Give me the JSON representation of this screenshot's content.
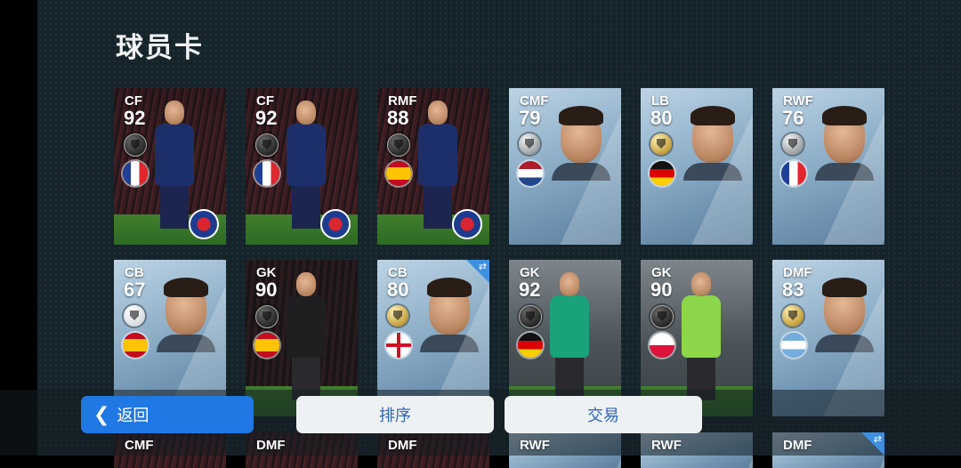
{
  "page": {
    "title": "球员卡"
  },
  "cards": [
    {
      "pos": "CF",
      "ovr": "92",
      "tier": "black",
      "flag": "fr",
      "style": "photo",
      "club": true
    },
    {
      "pos": "CF",
      "ovr": "92",
      "tier": "black",
      "flag": "fr",
      "style": "photo",
      "club": true
    },
    {
      "pos": "RMF",
      "ovr": "88",
      "tier": "black",
      "flag": "es",
      "style": "photo",
      "club": true
    },
    {
      "pos": "CMF",
      "ovr": "79",
      "tier": "silver",
      "flag": "nl",
      "style": "portrait",
      "club": false
    },
    {
      "pos": "LB",
      "ovr": "80",
      "tier": "gold",
      "flag": "de",
      "style": "portrait",
      "club": false
    },
    {
      "pos": "RWF",
      "ovr": "76",
      "tier": "silver",
      "flag": "fr",
      "style": "portrait",
      "club": false
    },
    {
      "pos": "CB",
      "ovr": "67",
      "tier": "white",
      "flag": "es",
      "style": "portrait",
      "club": false
    },
    {
      "pos": "GK",
      "ovr": "90",
      "tier": "black",
      "flag": "es",
      "style": "photo-dark",
      "club": false
    },
    {
      "pos": "CB",
      "ovr": "80",
      "tier": "gold",
      "flag": "en",
      "style": "portrait",
      "club": false,
      "swap": true
    },
    {
      "pos": "GK",
      "ovr": "92",
      "tier": "black",
      "flag": "de",
      "style": "photo-stadium",
      "club": false
    },
    {
      "pos": "GK",
      "ovr": "90",
      "tier": "black",
      "flag": "pl",
      "style": "photo-stadium",
      "club": false
    },
    {
      "pos": "DMF",
      "ovr": "83",
      "tier": "gold",
      "flag": "ar",
      "style": "portrait",
      "club": false
    }
  ],
  "partial_cards": [
    {
      "pos": "CMF"
    },
    {
      "pos": "DMF"
    },
    {
      "pos": "DMF"
    },
    {
      "pos": "RWF"
    },
    {
      "pos": "RWF"
    },
    {
      "pos": "DMF",
      "swap": true
    }
  ],
  "buttons": {
    "back": "返回",
    "sort": "排序",
    "trade": "交易"
  },
  "icons": {
    "back": "chevron-left-icon",
    "swap": "swap-arrows-icon"
  },
  "colors": {
    "accent": "#1f78e4",
    "background": "#15242a"
  }
}
